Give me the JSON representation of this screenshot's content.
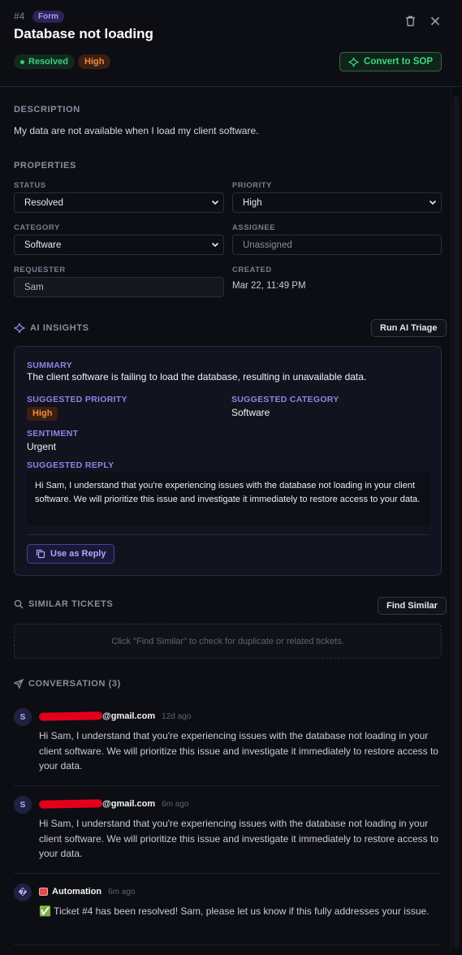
{
  "header": {
    "ticket_number": "#4",
    "type_badge": "Form",
    "title": "Database not loading",
    "status_badge": "Resolved",
    "priority_badge": "High",
    "convert_label": "Convert to SOP"
  },
  "description": {
    "label": "DESCRIPTION",
    "text": "My data are not available when I load my client software."
  },
  "properties": {
    "label": "PROPERTIES",
    "status_label": "STATUS",
    "status_value": "Resolved",
    "priority_label": "PRIORITY",
    "priority_value": "High",
    "category_label": "CATEGORY",
    "category_value": "Software",
    "assignee_label": "ASSIGNEE",
    "assignee_placeholder": "Unassigned",
    "requester_label": "REQUESTER",
    "requester_value": "Sam",
    "created_label": "CREATED",
    "created_value": "Mar 22, 11:49 PM"
  },
  "ai": {
    "heading": "AI INSIGHTS",
    "run_label": "Run AI Triage",
    "summary_label": "SUMMARY",
    "summary_text": "The client software is failing to load the database, resulting in unavailable data.",
    "priority_label": "SUGGESTED PRIORITY",
    "priority_value": "High",
    "category_label": "SUGGESTED CATEGORY",
    "category_value": "Software",
    "sentiment_label": "SENTIMENT",
    "sentiment_value": "Urgent",
    "reply_label": "SUGGESTED REPLY",
    "reply_text": "Hi Sam, I understand that you're experiencing issues with the database not loading in your client software. We will prioritize this issue and investigate it immediately to restore access to your data.",
    "use_reply_label": "Use as Reply"
  },
  "similar": {
    "heading": "SIMILAR TICKETS",
    "find_label": "Find Similar",
    "empty_text": "Click \"Find Similar\" to check for duplicate or related tickets."
  },
  "conversation": {
    "heading": "CONVERSATION (3)",
    "messages": [
      {
        "initial": "S",
        "author_suffix": "@gmail.com",
        "time": "12d ago",
        "body": "Hi Sam, I understand that you're experiencing issues with the database not loading in your client software. We will prioritize this issue and investigate it immediately to restore access to your data."
      },
      {
        "initial": "S",
        "author_suffix": "@gmail.com",
        "time": "6m ago",
        "body": "Hi Sam, I understand that you're experiencing issues with the database not loading in your client software. We will prioritize this issue and investigate it immediately to restore access to your data."
      },
      {
        "initial": "�",
        "author": "Automation",
        "time": "6m ago",
        "body": "✅ Ticket #4 has been resolved! Sam, please let us know if this fully addresses your issue."
      }
    ]
  }
}
